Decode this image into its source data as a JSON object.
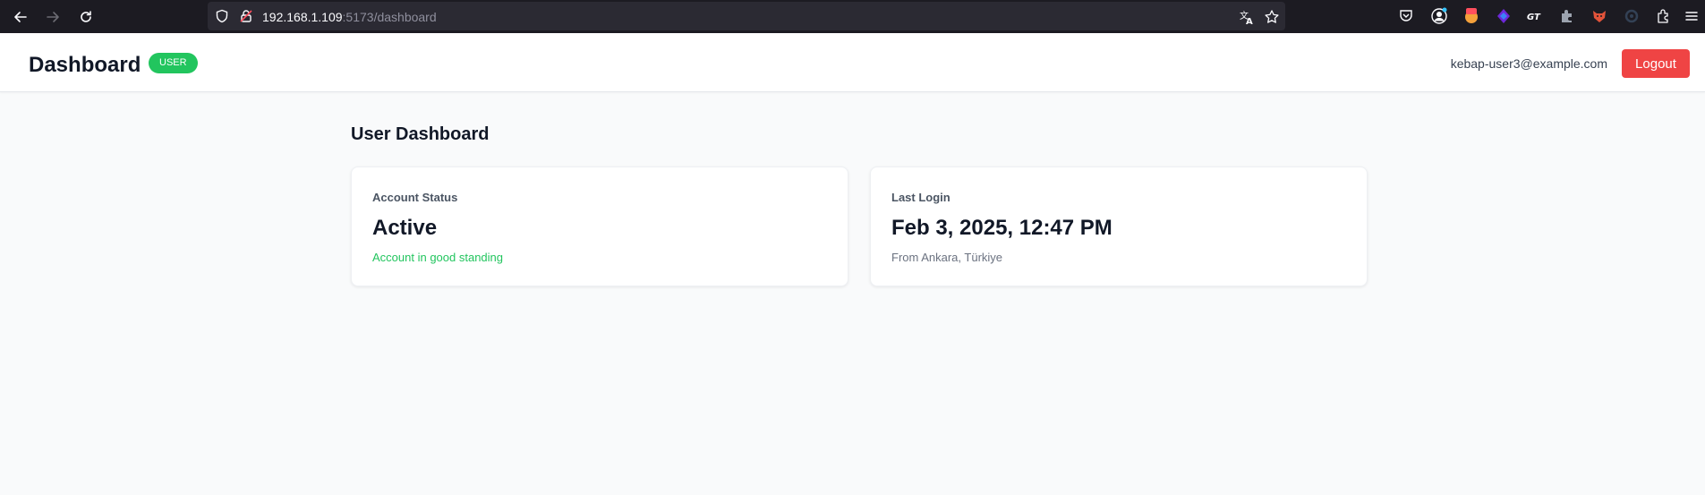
{
  "browser": {
    "url_host": "192.168.1.109",
    "url_path": ":5173/dashboard"
  },
  "header": {
    "title": "Dashboard",
    "role_badge": "USER",
    "user_email": "kebap-user3@example.com",
    "logout_label": "Logout"
  },
  "main": {
    "title": "User Dashboard",
    "cards": [
      {
        "label": "Account Status",
        "value": "Active",
        "note": "Account in good standing"
      },
      {
        "label": "Last Login",
        "value": "Feb 3, 2025, 12:47 PM",
        "note": "From Ankara, Türkiye"
      }
    ]
  },
  "colors": {
    "badge": "#22c55e",
    "logout": "#ef4444",
    "good": "#22c55e"
  }
}
